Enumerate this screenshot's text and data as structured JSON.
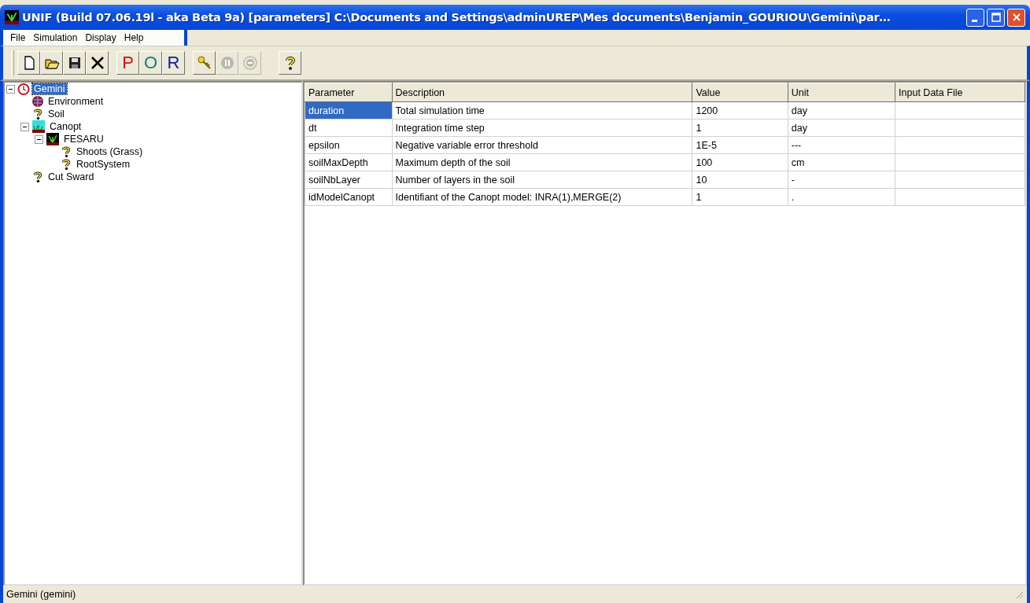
{
  "window": {
    "title": "UNIF (Build 07.06.19l - aka Beta 9a)  [parameters] C:\\Documents and Settings\\adminUREP\\Mes documents\\Benjamin_GOURIOU\\Gemini\\par…"
  },
  "menu": [
    "File",
    "Simulation",
    "Display",
    "Help"
  ],
  "toolbar": [
    {
      "kind": "new",
      "disabled": false
    },
    {
      "kind": "open",
      "disabled": false
    },
    {
      "kind": "save",
      "disabled": false
    },
    {
      "kind": "close",
      "disabled": false
    },
    {
      "kind": "letter",
      "label": "P",
      "color": "#d01010",
      "disabled": false
    },
    {
      "kind": "letter",
      "label": "O",
      "color": "#108080",
      "disabled": false
    },
    {
      "kind": "letter",
      "label": "R",
      "color": "#1020a0",
      "disabled": false
    },
    {
      "kind": "key",
      "disabled": false
    },
    {
      "kind": "pause",
      "disabled": true
    },
    {
      "kind": "stop",
      "disabled": true
    },
    {
      "kind": "help",
      "disabled": false
    }
  ],
  "tree": [
    {
      "label": "Gemini",
      "kind": "clock",
      "selected": true,
      "expanded": true,
      "children": [
        {
          "label": "Environment",
          "kind": "globe",
          "selected": false
        },
        {
          "label": "Soil",
          "kind": "question",
          "selected": false
        },
        {
          "label": "Canopt",
          "kind": "meadow",
          "selected": false,
          "expanded": true,
          "children": [
            {
              "label": "FESARU",
              "kind": "grass",
              "selected": false,
              "expanded": true,
              "children": [
                {
                  "label": "Shoots (Grass)",
                  "kind": "question",
                  "selected": false
                },
                {
                  "label": "RootSystem",
                  "kind": "question",
                  "selected": false
                }
              ]
            }
          ]
        },
        {
          "label": "Cut Sward",
          "kind": "question",
          "selected": false
        }
      ]
    }
  ],
  "table": {
    "columns": [
      "Parameter",
      "Description",
      "Value",
      "Unit",
      "Input Data File"
    ],
    "rows": [
      {
        "selected": true,
        "cells": [
          "duration",
          "Total simulation time",
          "1200",
          "day",
          ""
        ]
      },
      {
        "selected": false,
        "cells": [
          "dt",
          "Integration time step",
          "1",
          "day",
          ""
        ]
      },
      {
        "selected": false,
        "cells": [
          "epsilon",
          "Negative variable error threshold",
          "1E-5",
          "---",
          ""
        ]
      },
      {
        "selected": false,
        "cells": [
          "soilMaxDepth",
          "Maximum depth of the soil",
          "100",
          "cm",
          ""
        ]
      },
      {
        "selected": false,
        "cells": [
          "soilNbLayer",
          "Number of layers in the soil",
          "10",
          "-",
          ""
        ]
      },
      {
        "selected": false,
        "cells": [
          "idModelCanopt",
          "Identifiant of the Canopt model: INRA(1),MERGE(2)",
          "1",
          ".",
          ""
        ]
      }
    ]
  },
  "status_bar": "Gemini (gemini)"
}
